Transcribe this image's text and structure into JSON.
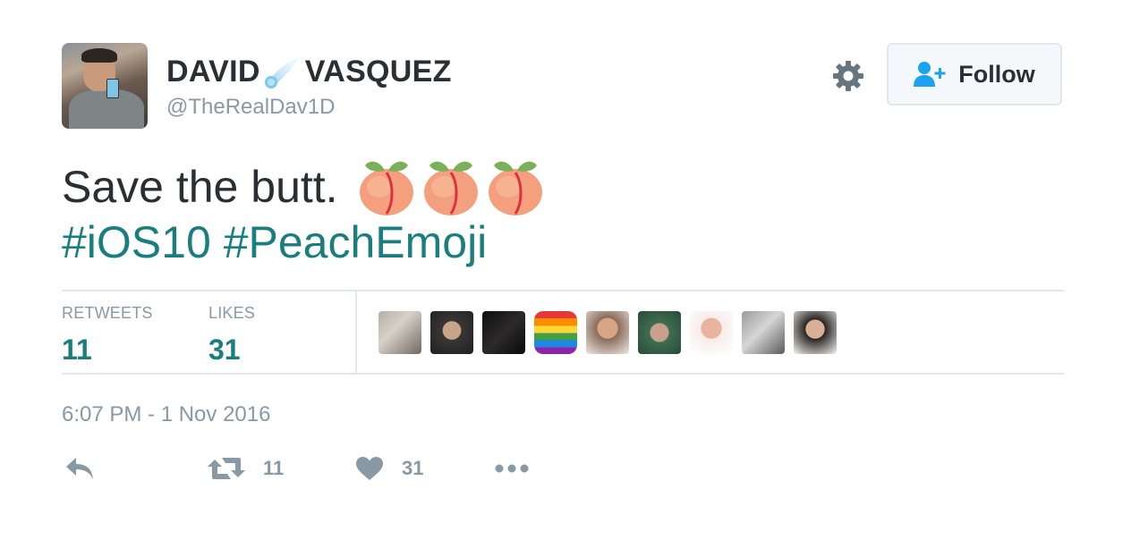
{
  "user": {
    "display_name_first": "DAVID",
    "display_name_second": "VASQUEZ",
    "handle": "@TheRealDav1D"
  },
  "follow": {
    "label": "Follow"
  },
  "tweet": {
    "text": "Save the butt.",
    "hashtags": [
      "#iOS10",
      "#PeachEmoji"
    ]
  },
  "stats": {
    "retweets_label": "RETWEETS",
    "retweets_value": "11",
    "likes_label": "LIKES",
    "likes_value": "31"
  },
  "timestamp": "6:07 PM - 1 Nov 2016",
  "actions": {
    "retweet_count": "11",
    "like_count": "31"
  },
  "colors": {
    "link": "#1b7e7e",
    "muted": "#8899a6",
    "text": "#292f33",
    "border": "#e1e8ed"
  },
  "icons": [
    "comet-emoji",
    "gear-icon",
    "follow-person-icon",
    "peach-emoji",
    "reply-icon",
    "retweet-icon",
    "heart-icon",
    "more-icon"
  ]
}
